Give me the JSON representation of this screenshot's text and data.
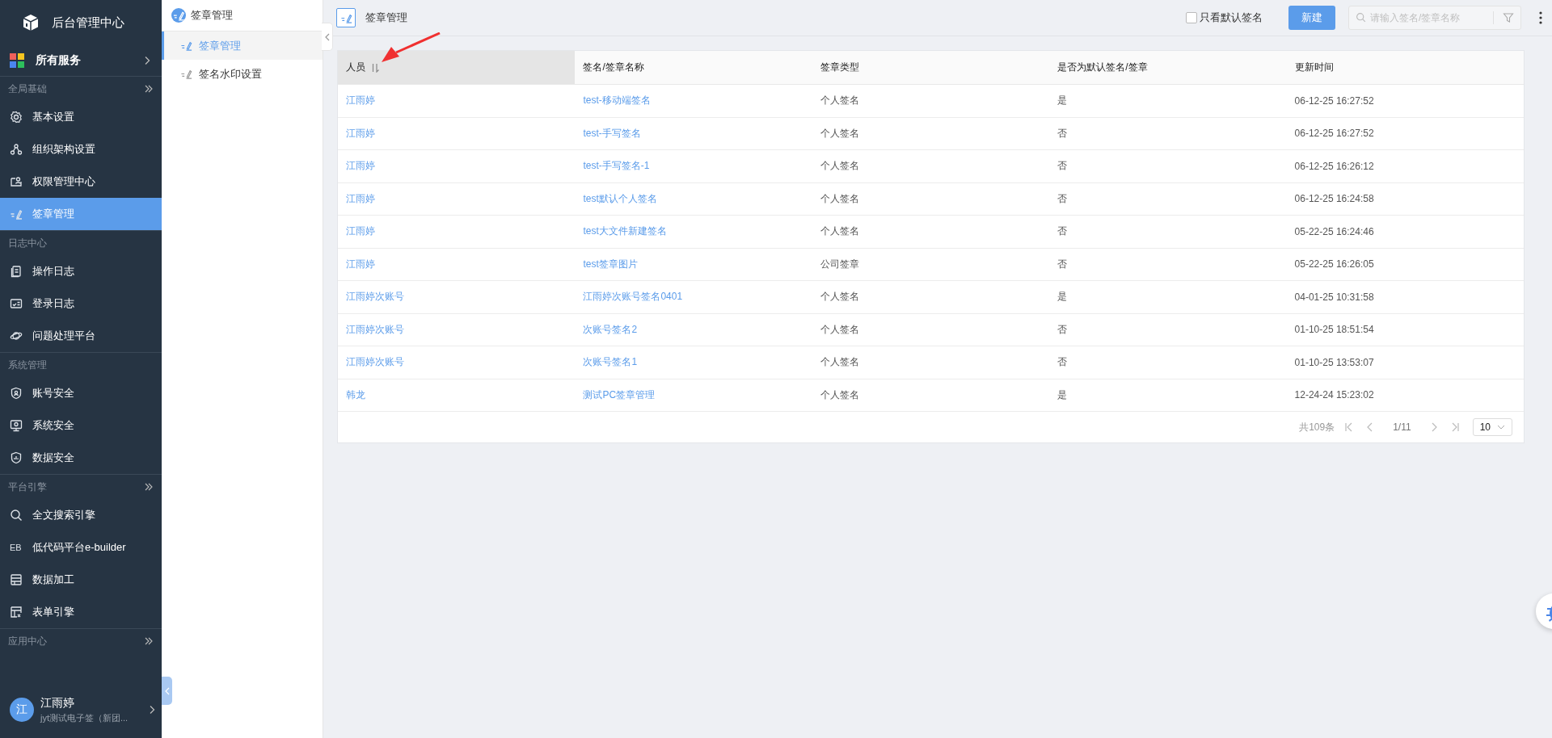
{
  "app": {
    "title": "后台管理中心"
  },
  "all_services": {
    "label": "所有服务"
  },
  "sidebar": {
    "items": [
      {
        "kind": "section",
        "label": "全局基础",
        "collapsible": true
      },
      {
        "kind": "item",
        "label": "基本设置",
        "selected": false
      },
      {
        "kind": "item",
        "label": "组织架构设置",
        "selected": false
      },
      {
        "kind": "item",
        "label": "权限管理中心",
        "selected": false
      },
      {
        "kind": "item",
        "label": "签章管理",
        "selected": true
      },
      {
        "kind": "section",
        "label": "日志中心",
        "collapsible": false
      },
      {
        "kind": "item",
        "label": "操作日志",
        "selected": false
      },
      {
        "kind": "item",
        "label": "登录日志",
        "selected": false
      },
      {
        "kind": "item",
        "label": "问题处理平台",
        "selected": false
      },
      {
        "kind": "section",
        "label": "系统管理",
        "collapsible": false
      },
      {
        "kind": "item",
        "label": "账号安全",
        "selected": false
      },
      {
        "kind": "item",
        "label": "系统安全",
        "selected": false
      },
      {
        "kind": "item",
        "label": "数据安全",
        "selected": false
      },
      {
        "kind": "section",
        "label": "平台引擎",
        "collapsible": true
      },
      {
        "kind": "item",
        "label": "全文搜索引擎",
        "selected": false
      },
      {
        "kind": "item",
        "label": "低代码平台e-builder",
        "icon_text": "EB",
        "selected": false
      },
      {
        "kind": "item",
        "label": "数据加工",
        "selected": false
      },
      {
        "kind": "item",
        "label": "表单引擎",
        "selected": false
      },
      {
        "kind": "section",
        "label": "应用中心",
        "collapsible": true
      }
    ]
  },
  "user": {
    "avatar": "江",
    "name": "江雨婷",
    "org": "jyt测试电子签（新团..."
  },
  "submenu": {
    "title": "签章管理",
    "items": [
      {
        "label": "签章管理",
        "selected": true
      },
      {
        "label": "签名水印设置",
        "selected": false
      }
    ]
  },
  "header": {
    "title": "签章管理",
    "default_only": {
      "label": "只看默认签名",
      "checked": false
    },
    "new_button": "新建",
    "search": {
      "placeholder": "请输入签名/签章名称"
    }
  },
  "table": {
    "columns": [
      {
        "label": "人员",
        "sorted": true
      },
      {
        "label": "签名/签章名称",
        "sorted": false
      },
      {
        "label": "签章类型",
        "sorted": false
      },
      {
        "label": "是否为默认签名/签章",
        "sorted": false
      },
      {
        "label": "更新时间",
        "sorted": false
      }
    ],
    "rows": [
      [
        "江雨婷",
        "test-移动端签名",
        "个人签名",
        "是",
        "06-12-25 16:27:52"
      ],
      [
        "江雨婷",
        "test-手写签名",
        "个人签名",
        "否",
        "06-12-25 16:27:52"
      ],
      [
        "江雨婷",
        "test-手写签名-1",
        "个人签名",
        "否",
        "06-12-25 16:26:12"
      ],
      [
        "江雨婷",
        "test默认个人签名",
        "个人签名",
        "否",
        "06-12-25 16:24:58"
      ],
      [
        "江雨婷",
        "test大文件新建签名",
        "个人签名",
        "否",
        "05-22-25 16:24:46"
      ],
      [
        "江雨婷",
        "test签章图片",
        "公司签章",
        "否",
        "05-22-25 16:26:05"
      ],
      [
        "江雨婷次账号",
        "江雨婷次账号签名0401",
        "个人签名",
        "是",
        "04-01-25 10:31:58"
      ],
      [
        "江雨婷次账号",
        "次账号签名2",
        "个人签名",
        "否",
        "01-10-25 18:51:54"
      ],
      [
        "江雨婷次账号",
        "次账号签名1",
        "个人签名",
        "否",
        "01-10-25 13:53:07"
      ],
      [
        "韩龙",
        "测试PC签章管理",
        "个人签名",
        "是",
        "12-24-24 15:23:02"
      ]
    ]
  },
  "pagination": {
    "total": "共109条",
    "page": "1/11",
    "page_size": "10"
  }
}
